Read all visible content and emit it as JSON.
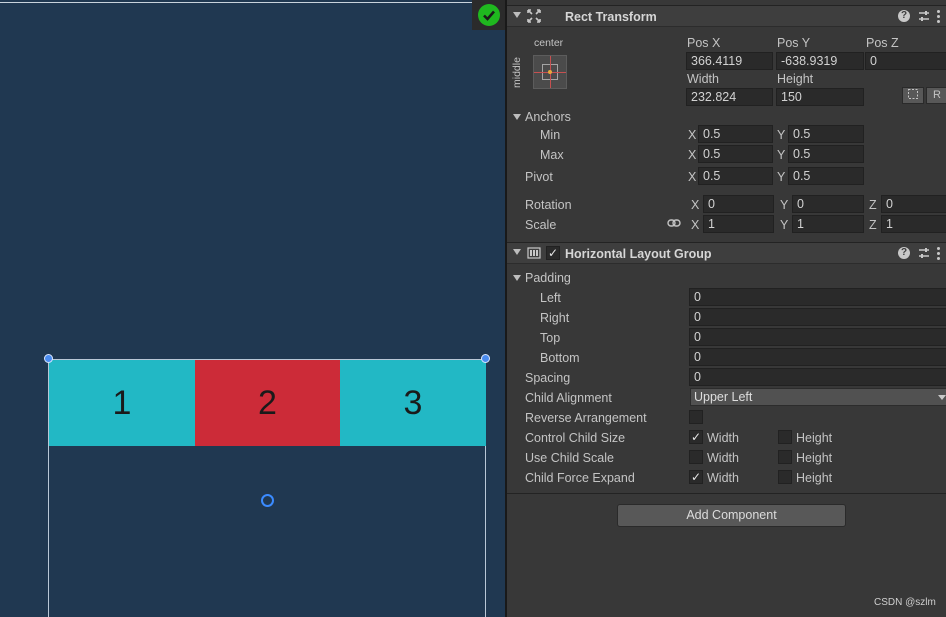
{
  "scene": {
    "cells": [
      "1",
      "2",
      "3"
    ],
    "status_icon": "check-icon",
    "colors": {
      "background": "#203851",
      "cell_teal": "#22b8c5",
      "cell_red": "#cc2b38"
    }
  },
  "rect_transform": {
    "title": "Rect Transform",
    "anchor_preset": {
      "horizontal": "center",
      "vertical": "middle"
    },
    "labels": {
      "pos_x": "Pos X",
      "pos_y": "Pos Y",
      "pos_z": "Pos Z",
      "width": "Width",
      "height": "Height"
    },
    "values": {
      "pos_x": "366.4119",
      "pos_y": "-638.9319",
      "pos_z": "0",
      "width": "232.824",
      "height": "150"
    },
    "raw_button": "R",
    "anchors": {
      "label": "Anchors",
      "min_label": "Min",
      "min_x": "0.5",
      "min_y": "0.5",
      "max_label": "Max",
      "max_x": "0.5",
      "max_y": "0.5"
    },
    "pivot": {
      "label": "Pivot",
      "x": "0.5",
      "y": "0.5"
    },
    "rotation": {
      "label": "Rotation",
      "x": "0",
      "y": "0",
      "z": "0"
    },
    "scale": {
      "label": "Scale",
      "x": "1",
      "y": "1",
      "z": "1"
    },
    "axes": {
      "x": "X",
      "y": "Y",
      "z": "Z"
    }
  },
  "horizontal_layout_group": {
    "title": "Horizontal Layout Group",
    "enabled": true,
    "padding": {
      "label": "Padding",
      "left_label": "Left",
      "left": "0",
      "right_label": "Right",
      "right": "0",
      "top_label": "Top",
      "top": "0",
      "bottom_label": "Bottom",
      "bottom": "0"
    },
    "spacing": {
      "label": "Spacing",
      "value": "0"
    },
    "child_alignment": {
      "label": "Child Alignment",
      "value": "Upper Left"
    },
    "reverse_arrangement": {
      "label": "Reverse Arrangement",
      "checked": false
    },
    "width_label": "Width",
    "height_label": "Height",
    "control_child_size": {
      "label": "Control Child Size",
      "width": true,
      "height": false
    },
    "use_child_scale": {
      "label": "Use Child Scale",
      "width": false,
      "height": false
    },
    "child_force_expand": {
      "label": "Child Force Expand",
      "width": true,
      "height": false
    }
  },
  "add_component": "Add Component",
  "watermark": "CSDN @szlm"
}
